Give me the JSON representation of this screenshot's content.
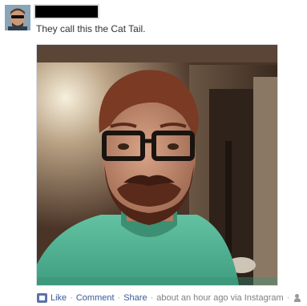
{
  "post": {
    "author_name": "",
    "message": "They call this the Cat Tail."
  },
  "icons": {
    "avatar": "user-avatar-photo",
    "like": "like-icon",
    "audience": "friends-icon"
  },
  "actions": {
    "like_label": "Like",
    "comment_label": "Comment",
    "share_label": "Share",
    "separator": "·",
    "timestamp": "about an hour ago via Instagram"
  },
  "colors": {
    "link": "#3b5998",
    "meta_text": "#808080",
    "message_text": "#333333"
  }
}
